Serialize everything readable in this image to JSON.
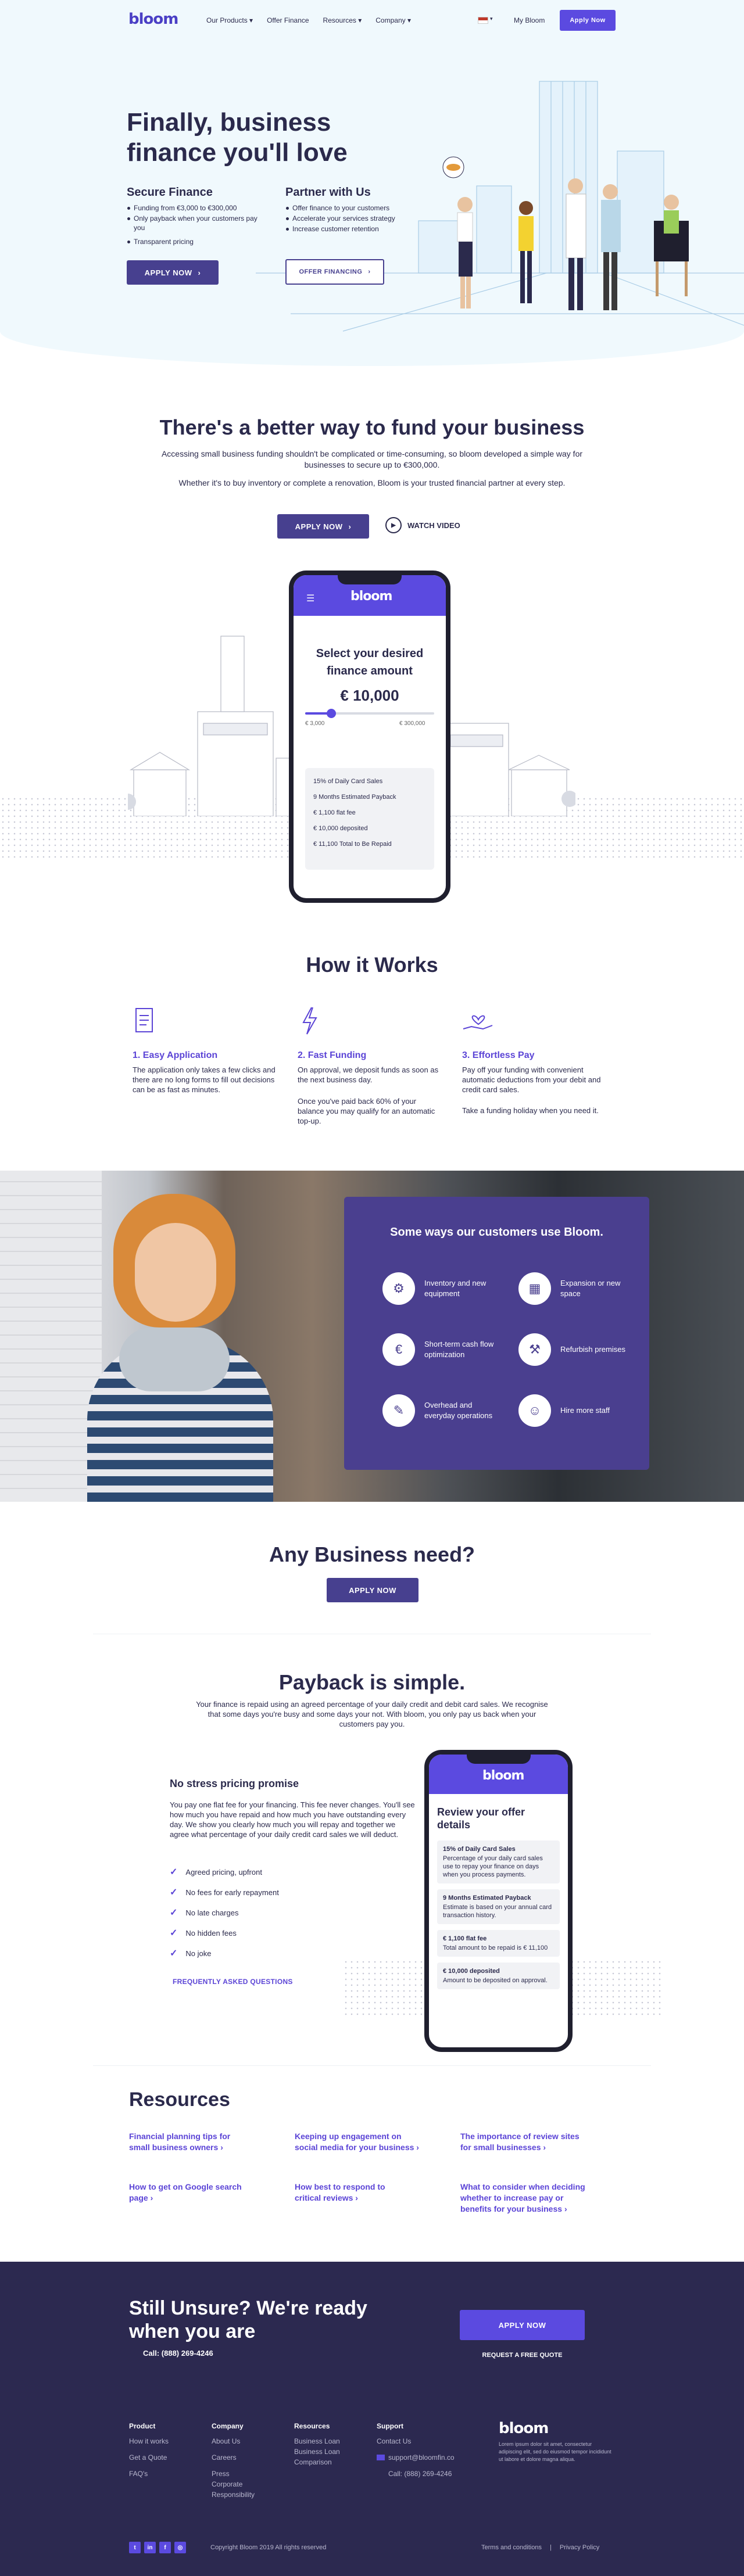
{
  "nav": {
    "logo": "bloom",
    "links": [
      "Our Products",
      "Offer Finance",
      "Resources",
      "Company"
    ],
    "login": "My Bloom",
    "apply": "Apply Now"
  },
  "hero": {
    "title": "Finally, business finance you'll love",
    "secure": {
      "title": "Secure Finance",
      "bullets": [
        "Funding from €3,000 to €300,000",
        "Only payback when your customers pay you",
        "Transparent pricing"
      ],
      "button": "APPLY NOW"
    },
    "partner": {
      "title": "Partner with Us",
      "bullets": [
        "Offer finance to your customers",
        "Accelerate your services strategy",
        "Increase customer retention"
      ],
      "button": "OFFER FINANCING"
    }
  },
  "better": {
    "title": "There's a better way to fund your business",
    "p1": "Accessing small business funding shouldn't be complicated or time-consuming, so bloom developed a simple way for businesses to secure up to €300,000.",
    "p2": "Whether it's to buy inventory or complete a renovation, Bloom is your trusted financial partner at every step.",
    "apply": "APPLY NOW",
    "video": "WATCH VIDEO"
  },
  "calculator": {
    "logo": "bloom",
    "heading": "Select your desired finance amount",
    "amount": "€ 10,000",
    "min": "€ 3,000",
    "max": "€ 300,000",
    "slider_fraction": 0.0235,
    "rows": [
      "15% of Daily Card Sales",
      "9 Months Estimated Payback",
      "€ 1,100 flat fee",
      "€ 10,000 deposited",
      "€ 11,100 Total to Be Repaid"
    ]
  },
  "how": {
    "title": "How it Works",
    "steps": [
      {
        "icon": "document-icon",
        "title": "1. Easy Application",
        "text": "The application only takes a few clicks and there are no long forms to fill out decisions can be as fast as minutes.",
        "text2": ""
      },
      {
        "icon": "lightning-icon",
        "title": "2. Fast Funding",
        "text": "On approval, we deposit funds as soon as the next business day.",
        "text2": "Once you've paid back 60% of your balance you may qualify for an automatic top-up."
      },
      {
        "icon": "hand-heart-icon",
        "title": "3. Effortless Pay",
        "text": "Pay off your funding with convenient automatic deductions from your debit and credit card sales.",
        "text2": "Take a funding holiday when you need it."
      }
    ]
  },
  "ways": {
    "title": "Some ways our customers use Bloom.",
    "items": [
      {
        "icon": "equipment-icon",
        "glyph": "⚙",
        "label": "Inventory and new equipment"
      },
      {
        "icon": "expansion-icon",
        "glyph": "▦",
        "label": "Expansion or new space"
      },
      {
        "icon": "cashflow-icon",
        "glyph": "€",
        "label": "Short-term cash flow optimization"
      },
      {
        "icon": "refurbish-icon",
        "glyph": "⚒",
        "label": "Refurbish premises"
      },
      {
        "icon": "operations-icon",
        "glyph": "✎",
        "label": "Overhead and everyday operations"
      },
      {
        "icon": "staff-icon",
        "glyph": "☺",
        "label": "Hire more staff"
      }
    ]
  },
  "need": {
    "title": "Any Business need?",
    "button": "APPLY NOW"
  },
  "payback": {
    "title": "Payback is simple.",
    "intro": "Your finance is repaid using an agreed percentage of your daily credit and debit card sales. We recognise that some days you're busy and some days your not. With bloom, you only pay us back when your customers pay you.",
    "sub": "No stress pricing promise",
    "text": "You pay one flat fee for your financing. This fee never changes. You'll see how much you have repaid and how much you have outstanding every day. We show you clearly how much you will repay and together we agree what percentage of your daily credit card sales we will deduct.",
    "checks": [
      "Agreed pricing, upfront",
      "No fees for early repayment",
      "No late charges",
      "No hidden fees",
      "No joke"
    ],
    "faq": "FREQUENTLY ASKED QUESTIONS",
    "phone": {
      "logo": "bloom",
      "title": "Review your offer details",
      "boxes": [
        {
          "head": "15% of Daily Card Sales",
          "text": "Percentage of your daily card sales use to repay your finance on days when you process payments."
        },
        {
          "head": "9 Months Estimated Payback",
          "text": "Estimate is based on your annual card transaction history."
        },
        {
          "head": "€ 1,100 flat fee",
          "text": "Total amount to be repaid is € 11,100"
        },
        {
          "head": "€ 10,000 deposited",
          "text": "Amount to be deposited on approval."
        }
      ]
    }
  },
  "resources": {
    "title": "Resources",
    "links": [
      "Financial planning tips for small business owners",
      "Keeping up engagement on social media for your business",
      "The importance of review sites for small businesses",
      "How to get on Google search page",
      "How best to respond to critical reviews",
      "What to consider when deciding whether to increase pay or benefits for your business"
    ]
  },
  "cta": {
    "title": "Still Unsure? We're ready when you are",
    "call": "Call: (888) 269-4246",
    "apply": "APPLY NOW",
    "quote": "REQUEST A FREE QUOTE"
  },
  "footer": {
    "product": {
      "title": "Product",
      "links": [
        "How it works",
        "Get a Quote",
        "FAQ's"
      ]
    },
    "company": {
      "title": "Company",
      "links": [
        "About Us",
        "Careers",
        "Press",
        "Corporate Responsibility"
      ]
    },
    "resources": {
      "title": "Resources",
      "links": [
        "Business Loan",
        "Business Loan Comparison"
      ]
    },
    "support": {
      "title": "Support",
      "links": [
        "Contact Us"
      ],
      "email": "support@bloomfin.co",
      "phone": "Call: (888) 269-4246"
    },
    "logo": "bloom",
    "about": "Lorem ipsum dolor sit amet, consectetur adipiscing elit, sed do eiusmod tempor incididunt ut labore et dolore magna aliqua.",
    "copyright": "Copyright Bloom 2019 All rights reserved",
    "terms": "Terms and conditions",
    "privacy": "Privacy Policy",
    "social": [
      "twitter-icon",
      "linkedin-icon",
      "facebook-icon",
      "instagram-icon"
    ]
  },
  "colors": {
    "accent": "#5b4ae0",
    "dark": "#2c2950",
    "button": "#47408f",
    "card": "#4a3f8f"
  }
}
